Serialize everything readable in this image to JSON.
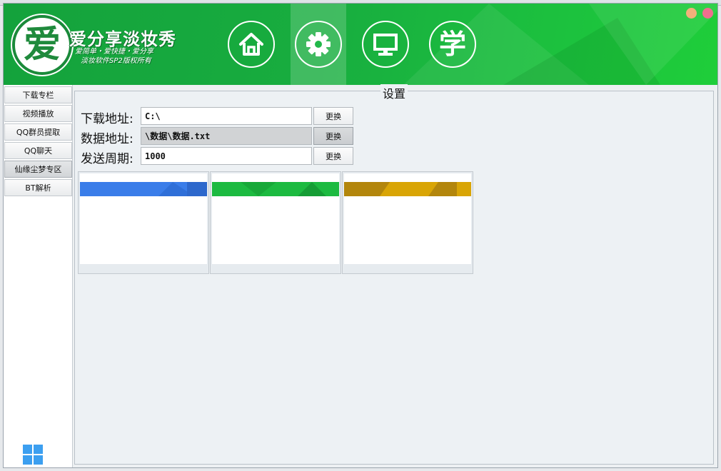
{
  "header": {
    "logo_char": "爱",
    "brand_title": "爱分享淡妆秀",
    "slogan": "爱简单・爱快捷・爱分享",
    "copyright": "淡妆软件SP2版权所有",
    "nav": [
      {
        "icon": "home-icon",
        "label": ""
      },
      {
        "icon": "gear-icon",
        "label": ""
      },
      {
        "icon": "monitor-icon",
        "label": ""
      },
      {
        "icon": "learn-icon",
        "label": "学"
      }
    ],
    "active_nav": 1
  },
  "window_controls": {
    "minimize_color": "#f3b07a",
    "close_color": "#ef6f8e"
  },
  "sidebar": {
    "items": [
      {
        "label": "下载专栏"
      },
      {
        "label": "视频播放"
      },
      {
        "label": "QQ群员提取"
      },
      {
        "label": "QQ聊天"
      },
      {
        "label": "仙缘尘梦专区"
      },
      {
        "label": "BT解析"
      }
    ],
    "selected_index": 4
  },
  "settings": {
    "title": "设置",
    "rows": [
      {
        "label": "下载地址:",
        "value": "C:\\",
        "button": "更换"
      },
      {
        "label": "数据地址:",
        "value": "\\数据\\数据.txt",
        "button": "更换"
      },
      {
        "label": "发送周期:",
        "value": "1000",
        "button": "更换"
      }
    ]
  },
  "theme_cards": [
    {
      "name": "blue",
      "color": "#3a7de9",
      "shade": "#2f6fd8"
    },
    {
      "name": "green",
      "color": "#1cba40",
      "shade": "#17a838"
    },
    {
      "name": "gold",
      "color": "#d9a505",
      "shade": "#b3860c"
    }
  ]
}
